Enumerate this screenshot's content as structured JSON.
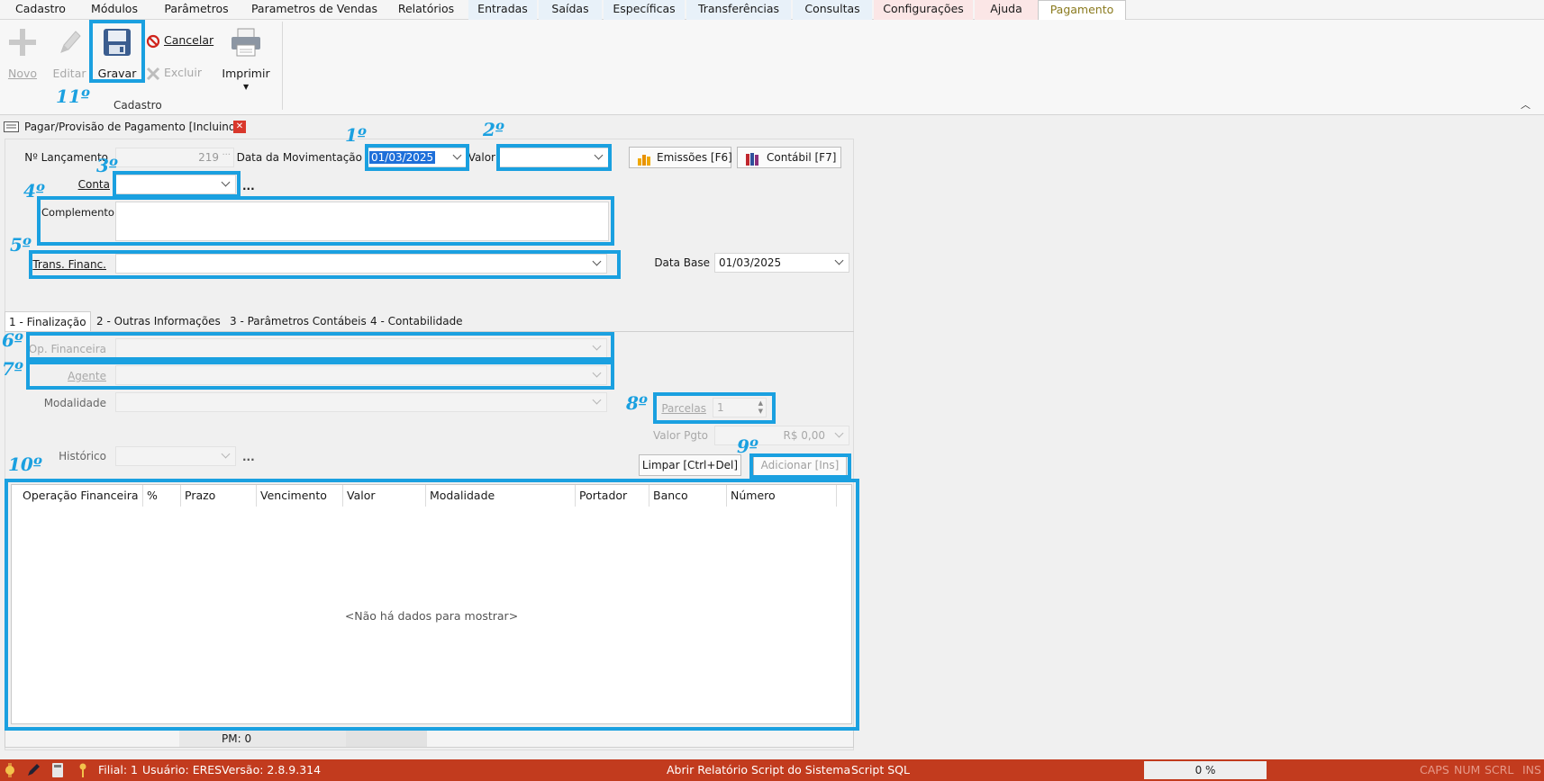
{
  "menu": {
    "items": [
      "Cadastro",
      "Módulos",
      "Parâmetros",
      "Parametros de Vendas",
      "Relatórios",
      "Entradas",
      "Saídas",
      "Específicas",
      "Transferências",
      "Consultas",
      "Configurações",
      "Ajuda",
      "Pagamento"
    ],
    "active": "Pagamento"
  },
  "ribbon": {
    "new_label": "Novo",
    "edit_label": "Editar",
    "save_label": "Gravar",
    "cancel_label": "Cancelar",
    "delete_label": "Excluir",
    "print_label": "Imprimir",
    "group_label": "Cadastro"
  },
  "document": {
    "tab_title": "Pagar/Provisão de Pagamento [Incluindo]"
  },
  "form": {
    "launch_label": "Nº Lançamento",
    "launch_value": "219",
    "movement_date_label": "Data da Movimentação",
    "movement_date_value": "01/03/2025",
    "value_label": "Valor",
    "value_value": "",
    "emissions_button": "Emissões [F6]",
    "accounting_button": "Contábil [F7]",
    "account_label": "Conta",
    "account_value": "",
    "complement_label": "Complemento",
    "complement_value": "",
    "trans_label": "Trans. Financ.",
    "trans_value": "",
    "base_date_label": "Data Base",
    "base_date_value": "01/03/2025",
    "more_dots": "..."
  },
  "tabs": [
    "1 - Finalização",
    "2 - Outras Informações",
    "3 - Parâmetros Contábeis",
    "4 - Contabilidade"
  ],
  "finalization": {
    "op_label": "Op. Financeira",
    "agent_label": "Agente",
    "modality_label": "Modalidade",
    "history_label": "Histórico",
    "installments_label": "Parcelas",
    "installments_value": "1",
    "payment_value_label": "Valor Pgto",
    "payment_value": "R$ 0,00",
    "clear_button": "Limpar [Ctrl+Del]",
    "add_button": "Adicionar [Ins]"
  },
  "grid": {
    "columns": [
      "Operação Financeira",
      "%",
      "Prazo",
      "Vencimento",
      "Valor",
      "Modalidade",
      "Portador",
      "Banco",
      "Número"
    ],
    "empty_text": "<Não há dados para mostrar>",
    "footer_text": "PM: 0"
  },
  "annotations": {
    "color": "#1aa0e0",
    "steps": [
      "1º",
      "2º",
      "3º",
      "4º",
      "5º",
      "6º",
      "7º",
      "8º",
      "9º",
      "10º",
      "11º"
    ]
  },
  "status": {
    "filial": "Filial: 1",
    "user": "Usuário: ERES",
    "version": "Versão: 2.8.9.314",
    "open_report": "Abrir Relatório",
    "system_script": "Script do Sistema",
    "sql_script": "Script SQL",
    "progress": "0 %",
    "caps": "CAPS",
    "num": "NUM",
    "scrl": "SCRL",
    "ins": "INS",
    "bar_color": "#c23b1e"
  }
}
